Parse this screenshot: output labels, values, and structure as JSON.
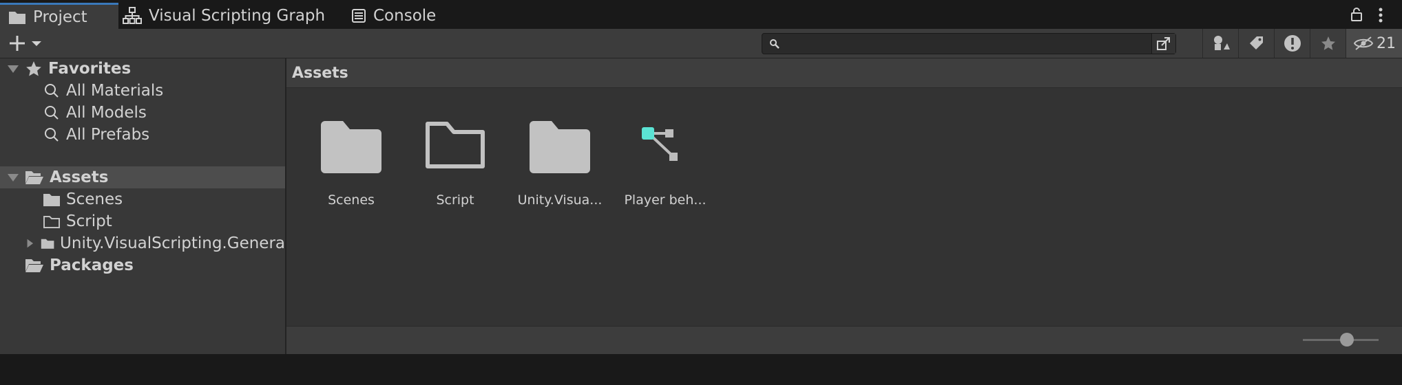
{
  "tabs": [
    {
      "label": "Project",
      "icon": "folder-icon"
    },
    {
      "label": "Visual Scripting Graph",
      "icon": "hierarchy-icon"
    },
    {
      "label": "Console",
      "icon": "console-icon"
    }
  ],
  "toolbar": {
    "search_value": "",
    "hidden_count": "21"
  },
  "sidebar": {
    "favorites_label": "Favorites",
    "favorites": [
      "All Materials",
      "All Models",
      "All Prefabs"
    ],
    "assets_label": "Assets",
    "asset_children": [
      "Scenes",
      "Script",
      "Unity.VisualScripting.Genera"
    ],
    "packages_label": "Packages"
  },
  "main": {
    "breadcrumb": "Assets",
    "items": [
      {
        "label": "Scenes",
        "icon": "folder-filled-icon"
      },
      {
        "label": "Script",
        "icon": "folder-empty-icon"
      },
      {
        "label": "Unity.Visua...",
        "icon": "folder-filled-icon"
      },
      {
        "label": "Player beh...",
        "icon": "script-graph-icon"
      }
    ],
    "zoom_level": 0.58
  },
  "colors": {
    "accent": "#3a79bb",
    "graph_node": "#5be3d4",
    "folder": "#c2c2c2"
  }
}
